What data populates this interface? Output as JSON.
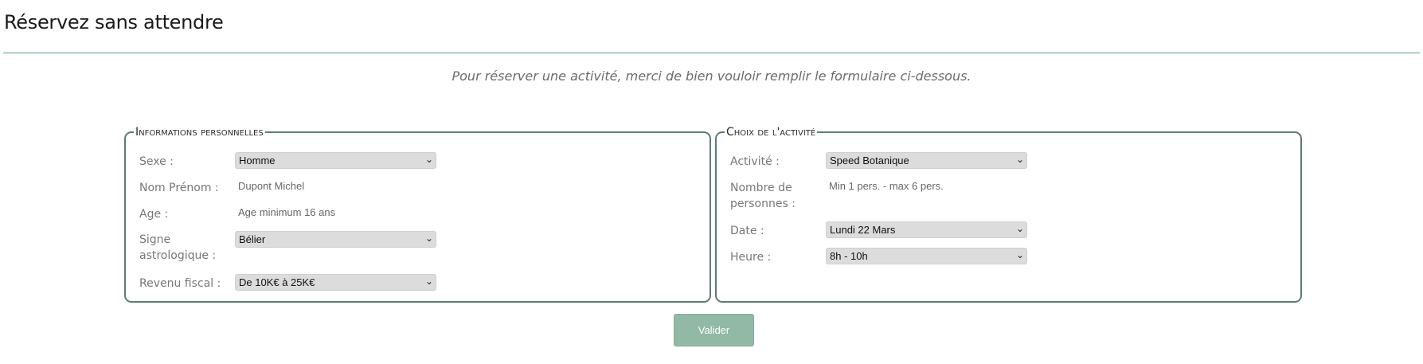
{
  "page": {
    "title": "Réservez sans attendre",
    "intro": "Pour réserver une activité, merci de bien vouloir remplir le formulaire ci-dessous."
  },
  "personal": {
    "legend": "Informations personnelles",
    "sexe_label": "Sexe :",
    "sexe_value": "Homme",
    "nom_label": "Nom Prénom :",
    "nom_placeholder": "Dupont Michel",
    "age_label": "Age :",
    "age_placeholder": "Age minimum 16 ans",
    "signe_label": "Signe astrologique :",
    "signe_value": "Bélier",
    "revenu_label": "Revenu fiscal :",
    "revenu_value": "De 10K€ à 25K€"
  },
  "activity": {
    "legend": "Choix de l'activité",
    "activite_label": "Activité :",
    "activite_value": "Speed Botanique",
    "nombre_label": "Nombre de personnes :",
    "nombre_placeholder": "Min 1 pers. - max 6 pers.",
    "date_label": "Date :",
    "date_value": "Lundi 22 Mars",
    "heure_label": "Heure :",
    "heure_value": "8h - 10h"
  },
  "actions": {
    "submit_label": "Valider"
  },
  "icons": {
    "select_chevron": "chevron-down-icon"
  },
  "colors": {
    "accent": "#5d9a8b",
    "panel_border": "#5b7c76",
    "button": "#92b8a6",
    "select_bg": "#dcdcdc"
  }
}
